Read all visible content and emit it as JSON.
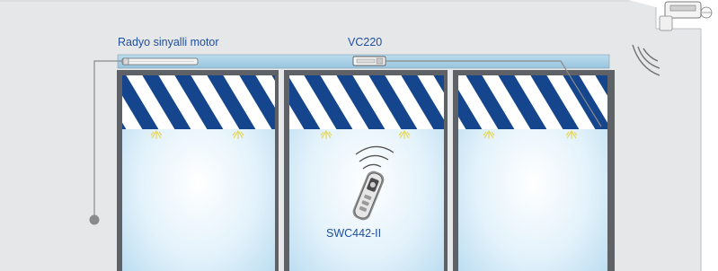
{
  "labels": {
    "motor": "Radyo sinyalli motor",
    "receiver": "VC220",
    "remote": "SWC442-II"
  },
  "colors": {
    "wall": "#e6e7e9",
    "rail": "#a9cfe4",
    "stripe_dark": "#15458c",
    "stripe_light": "#ffffff",
    "label": "#1f4e9c",
    "wire": "#8a8a8a",
    "light_glow": "#e6d85a"
  },
  "icons": [
    "motor-icon",
    "receiver-icon",
    "remote-control-icon",
    "radio-wave-icon",
    "sensor-icon"
  ]
}
